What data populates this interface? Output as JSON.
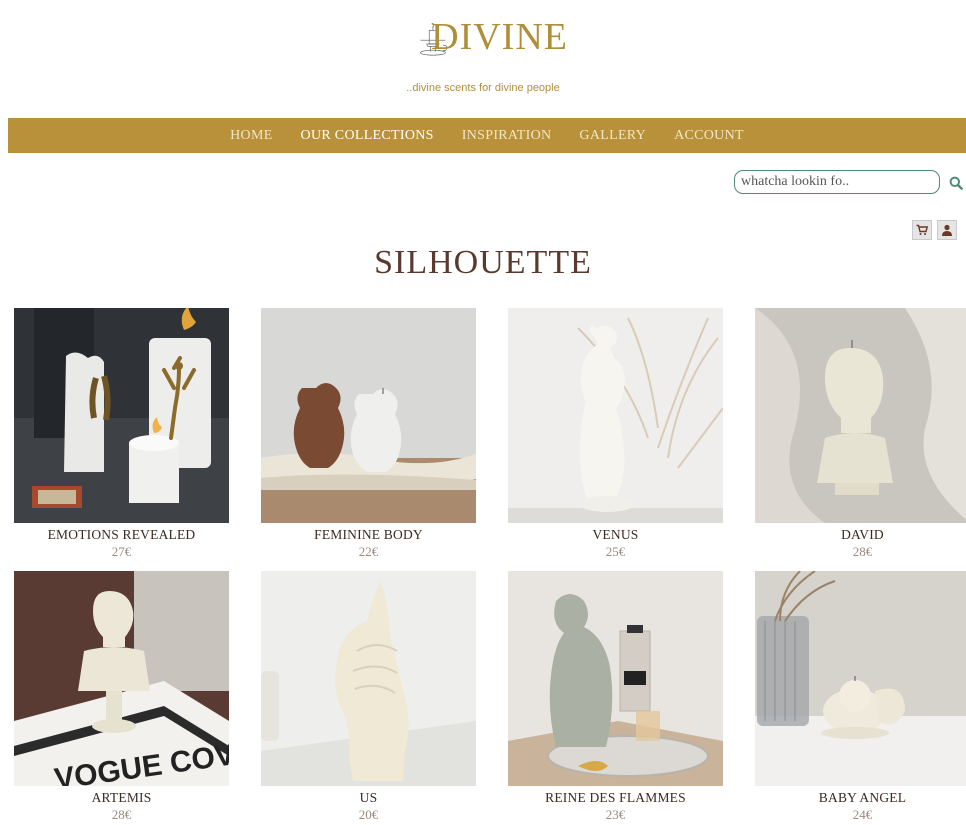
{
  "brand": {
    "name": "DIVINE",
    "tagline": "..divine scents for divine people",
    "color": "#b08f3a"
  },
  "nav": {
    "items": [
      {
        "label": "HOME",
        "active": false
      },
      {
        "label": "OUR COLLECTIONS",
        "active": true
      },
      {
        "label": "INSPIRATION",
        "active": false
      },
      {
        "label": "GALLERY",
        "active": false
      },
      {
        "label": "ACCOUNT",
        "active": false
      }
    ],
    "background": "#b8913a"
  },
  "search": {
    "placeholder": "whatcha lookin fo..",
    "value": ""
  },
  "icons": {
    "search": "search-icon",
    "cart": "cart-icon",
    "user": "user-icon"
  },
  "page": {
    "title": "SILHOUETTE"
  },
  "products": [
    {
      "name": "EMOTIONS REVEALED",
      "price": "27€"
    },
    {
      "name": "FEMININE BODY",
      "price": "22€"
    },
    {
      "name": "VENUS",
      "price": "25€"
    },
    {
      "name": "DAVID",
      "price": "28€"
    },
    {
      "name": "ARTEMIS",
      "price": "28€"
    },
    {
      "name": "US",
      "price": "20€"
    },
    {
      "name": "REINE DES FLAMMES",
      "price": "23€"
    },
    {
      "name": "BABY ANGEL",
      "price": "24€"
    }
  ],
  "photo_text": {
    "magazine": "VOGUE COVE"
  }
}
